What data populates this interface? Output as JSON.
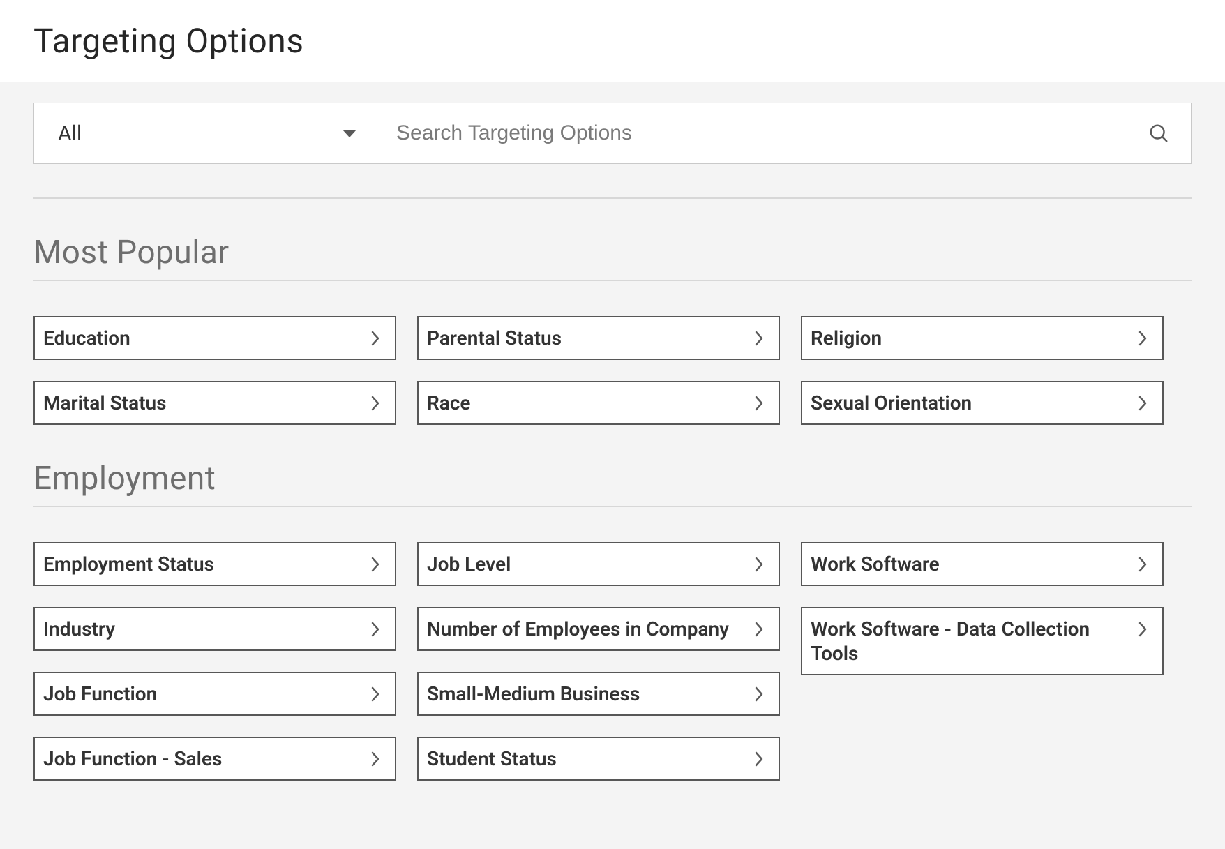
{
  "page_title": "Targeting Options",
  "filter": {
    "selected": "All"
  },
  "search": {
    "placeholder": "Search Targeting Options"
  },
  "sections": {
    "most_popular": {
      "title": "Most Popular",
      "col1": [
        "Education",
        "Marital Status"
      ],
      "col2": [
        "Parental Status",
        "Race"
      ],
      "col3": [
        "Religion",
        "Sexual Orientation"
      ]
    },
    "employment": {
      "title": "Employment",
      "col1": [
        "Employment Status",
        "Industry",
        "Job Function",
        "Job Function - Sales"
      ],
      "col2": [
        "Job Level",
        "Number of Employees in Company",
        "Small-Medium Business",
        "Student Status"
      ],
      "col3": [
        "Work Software",
        "Work Software - Data Collection Tools"
      ]
    }
  }
}
